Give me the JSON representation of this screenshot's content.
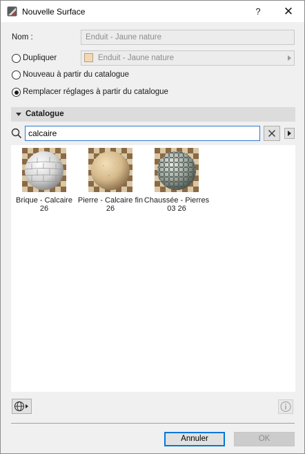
{
  "window": {
    "title": "Nouvelle Surface",
    "help_label": "?",
    "close_label": "✕",
    "app_icon": "surface-icon"
  },
  "form": {
    "name_label": "Nom :",
    "name_value": "Enduit - Jaune nature",
    "options": [
      {
        "label": "Dupliquer",
        "selected": false
      },
      {
        "label": "Nouveau à partir du catalogue",
        "selected": false
      },
      {
        "label": "Remplacer réglages à partir du catalogue",
        "selected": true
      }
    ],
    "duplicate_value": "Enduit - Jaune nature",
    "duplicate_swatch_color": "#f2d9b4"
  },
  "catalogue": {
    "title": "Catalogue",
    "search_value": "calcaire",
    "items": [
      {
        "name": "Brique - Calcaire 26",
        "thumbnail": "brick-sphere"
      },
      {
        "name": "Pierre - Calcaire fin 26",
        "thumbnail": "stone-sphere"
      },
      {
        "name": "Chaussée - Pierres 03 26",
        "thumbnail": "cobble-sphere"
      }
    ]
  },
  "footer": {
    "globe_icon": "globe-icon",
    "info_icon": "info-icon",
    "cancel_label": "Annuler",
    "ok_label": "OK"
  },
  "colors": {
    "accent": "#0078d7",
    "dialog_bg": "#f0f0f0",
    "section_header_bg": "#dcdcdc"
  }
}
